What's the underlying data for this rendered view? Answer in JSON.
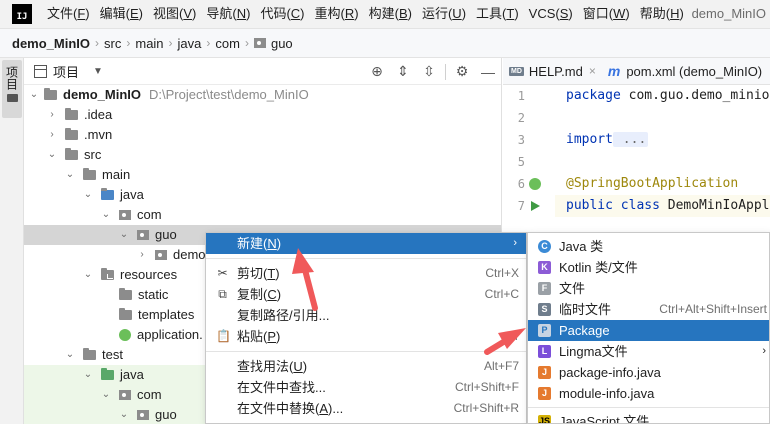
{
  "menubar": {
    "logo": "IJ",
    "items": [
      {
        "text": "文件(",
        "key": "F",
        "tail": ")"
      },
      {
        "text": "编辑(",
        "key": "E",
        "tail": ")"
      },
      {
        "text": "视图(",
        "key": "V",
        "tail": ")"
      },
      {
        "text": "导航(",
        "key": "N",
        "tail": ")"
      },
      {
        "text": "代码(",
        "key": "C",
        "tail": ")"
      },
      {
        "text": "重构(",
        "key": "R",
        "tail": ")"
      },
      {
        "text": "构建(",
        "key": "B",
        "tail": ")"
      },
      {
        "text": "运行(",
        "key": "U",
        "tail": ")"
      },
      {
        "text": "工具(",
        "key": "T",
        "tail": ")"
      },
      {
        "text": "VCS(",
        "key": "S",
        "tail": ")"
      },
      {
        "text": "窗口(",
        "key": "W",
        "tail": ")"
      },
      {
        "text": "帮助(",
        "key": "H",
        "tail": ")"
      }
    ],
    "window_title": "demo_MinIO"
  },
  "breadcrumb": [
    "demo_MinIO",
    "src",
    "main",
    "java",
    "com",
    "guo"
  ],
  "stripe": {
    "project_tab": "项目"
  },
  "project_panel": {
    "title": "项目",
    "root_name": "demo_MinIO",
    "root_path": "D:\\Project\\test\\demo_MinIO",
    "tree": [
      ".idea",
      ".mvn",
      "src",
      "main",
      "java",
      "com",
      "guo",
      "demo",
      "resources",
      "static",
      "templates",
      "application.",
      "test",
      "java",
      "com",
      "guo"
    ]
  },
  "editor": {
    "tabs": [
      {
        "icon": "MD",
        "label": "HELP.md"
      },
      {
        "icon": "m",
        "label": "pom.xml (demo_MinIO)"
      }
    ],
    "lines": [
      {
        "n": "1",
        "pre": "package",
        "rest": " com.guo.demo_minio"
      },
      {
        "n": "2",
        "pre": "",
        "rest": ""
      },
      {
        "n": "3",
        "pre": "import",
        "rest": " ..."
      },
      {
        "n": "5",
        "pre": "",
        "rest": ""
      },
      {
        "n": "6",
        "pre": "@SpringBootApplication",
        "rest": ""
      },
      {
        "n": "7",
        "pre": "public class",
        "rest": " DemoMinIoAppl"
      }
    ]
  },
  "context_menu": {
    "items": [
      {
        "label": "新建(",
        "key": "N",
        "tail": ")",
        "shortcut": ""
      },
      {
        "label": "剪切(",
        "key": "T",
        "tail": ")",
        "shortcut": "Ctrl+X"
      },
      {
        "label": "复制(",
        "key": "C",
        "tail": ")",
        "shortcut": "Ctrl+C"
      },
      {
        "label": "复制路径/引用...",
        "key": "",
        "tail": "",
        "shortcut": ""
      },
      {
        "label": "粘贴(",
        "key": "P",
        "tail": ")",
        "shortcut": "Ctr"
      },
      {
        "label": "查找用法(",
        "key": "U",
        "tail": ")",
        "shortcut": "Alt+F7"
      },
      {
        "label": "在文件中查找...",
        "key": "",
        "tail": "",
        "shortcut": "Ctrl+Shift+F"
      },
      {
        "label": "在文件中替换(",
        "key": "A",
        "tail": ")...",
        "shortcut": "Ctrl+Shift+R"
      }
    ]
  },
  "submenu": {
    "items": [
      {
        "icon": "C",
        "label": "Java 类",
        "shortcut": ""
      },
      {
        "icon": "K",
        "label": "Kotlin 类/文件",
        "shortcut": ""
      },
      {
        "icon": "F",
        "label": "文件",
        "shortcut": ""
      },
      {
        "icon": "S",
        "label": "临时文件",
        "shortcut": "Ctrl+Alt+Shift+Insert"
      },
      {
        "icon": "P",
        "label": "Package",
        "shortcut": ""
      },
      {
        "icon": "L",
        "label": "Lingma文件",
        "shortcut": ""
      },
      {
        "icon": "J",
        "label": "package-info.java",
        "shortcut": ""
      },
      {
        "icon": "J",
        "label": "module-info.java",
        "shortcut": ""
      },
      {
        "icon": "JS",
        "label": "JavaScript 文件",
        "shortcut": ""
      }
    ]
  },
  "colors": {
    "highlight": "#2675bf",
    "annotation_arrow": "#f0595a",
    "keyword": "#0033b3",
    "annotation": "#9e880d"
  }
}
